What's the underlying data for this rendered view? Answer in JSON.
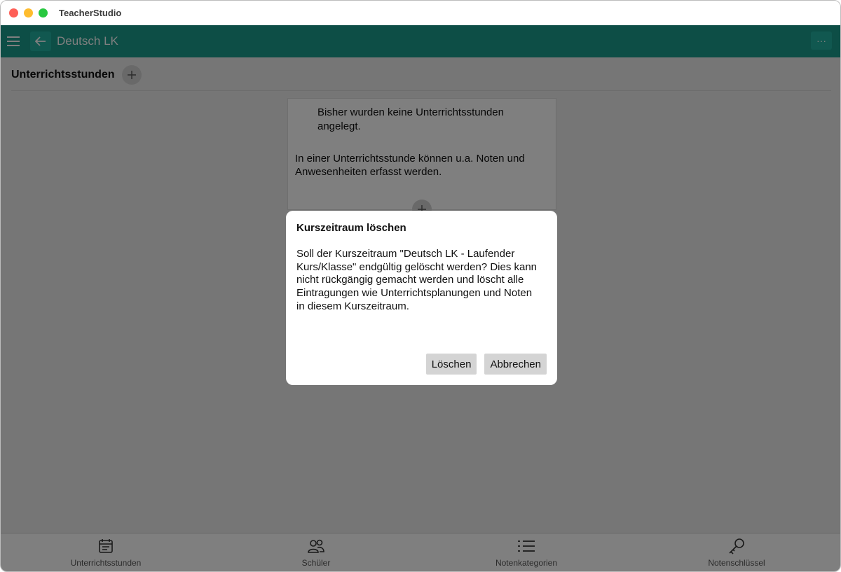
{
  "window": {
    "title": "TeacherStudio"
  },
  "appbar": {
    "title": "Deutsch LK",
    "more_label": "···"
  },
  "section": {
    "title": "Unterrichtsstunden"
  },
  "empty_state": {
    "line1": "Bisher wurden keine Unterrichtsstunden angelegt.",
    "line2": "In einer Unterrichtsstunde können u.a. Noten und Anwesenheiten erfasst werden."
  },
  "bottom_nav": {
    "items": [
      {
        "label": "Unterrichtsstunden",
        "icon": "calendar-icon"
      },
      {
        "label": "Schüler",
        "icon": "users-icon"
      },
      {
        "label": "Notenkategorien",
        "icon": "list-icon"
      },
      {
        "label": "Notenschlüssel",
        "icon": "key-icon"
      }
    ]
  },
  "dialog": {
    "title": "Kurszeitraum löschen",
    "body": "Soll der Kurszeitraum \"Deutsch LK - Laufender Kurs/Klasse\" endgültig gelöscht werden? Dies kann nicht rückgängig gemacht werden und löscht alle Eintragungen wie Unterrichtsplanungen und Noten in diesem Kurszeitraum.",
    "delete_label": "Löschen",
    "cancel_label": "Abbrechen"
  },
  "colors": {
    "appbar": "#1a9c8d",
    "overlay": "rgba(0,0,0,0.5)"
  }
}
